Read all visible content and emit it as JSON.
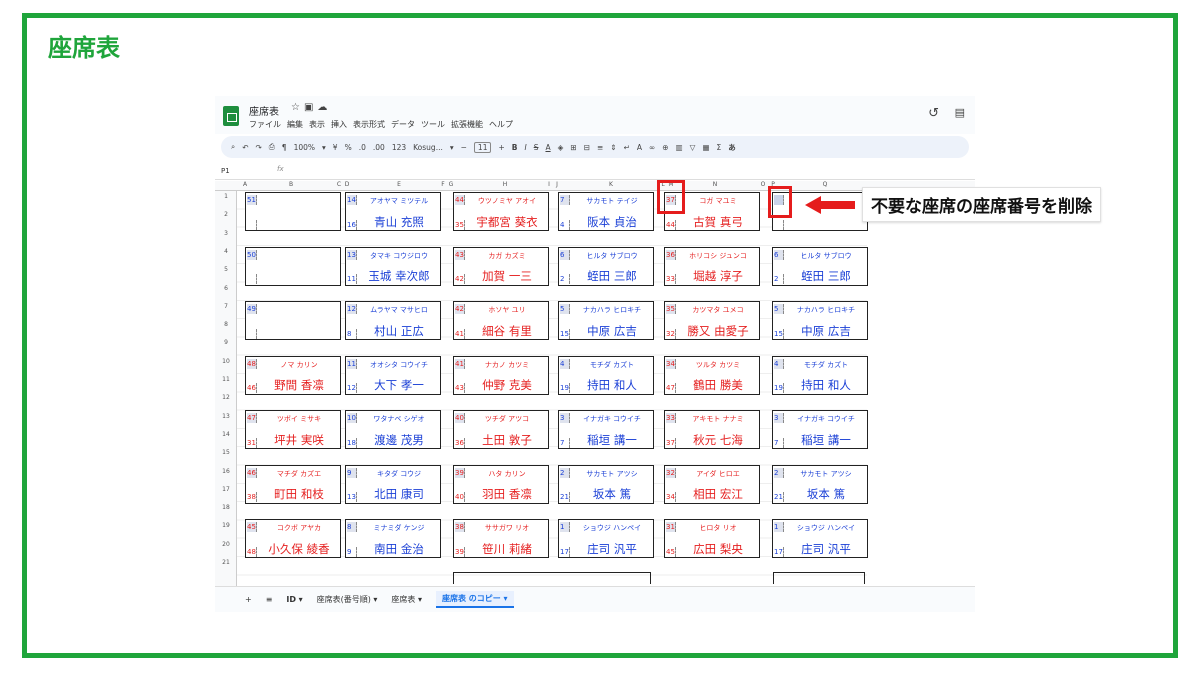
{
  "slide_title": "座席表",
  "callout_text": "不要な座席の座席番号を削除",
  "app": {
    "doc_title": "座席表",
    "menu": [
      "ファイル",
      "編集",
      "表示",
      "挿入",
      "表示形式",
      "データ",
      "ツール",
      "拡張機能",
      "ヘルプ"
    ],
    "zoom": "100%",
    "font": "Kosug...",
    "font_size": "11",
    "name_box": "P1",
    "fx": "fx",
    "columns": [
      "A",
      "B",
      "C",
      "D",
      "E",
      "F",
      "G",
      "H",
      "I",
      "J",
      "K",
      "L",
      "M",
      "N",
      "O",
      "P",
      "Q"
    ],
    "rows": [
      "1",
      "2",
      "3",
      "4",
      "5",
      "6",
      "7",
      "8",
      "9",
      "10",
      "11",
      "12",
      "13",
      "14",
      "15",
      "16",
      "17",
      "18",
      "19",
      "20",
      "21"
    ],
    "sheet_tabs": [
      "ID",
      "座席表(番号順)",
      "座席表",
      "座席表 のコピー"
    ]
  },
  "colors": {
    "accent": "#1fa53b",
    "blue_text": "#1a3fd6",
    "red_text": "#e52020",
    "highlight": "#e51c1c"
  },
  "seat_columns": [
    [
      {
        "n1": "51",
        "n2": "",
        "kana": "",
        "name": "",
        "color": "blue"
      },
      {
        "n1": "50",
        "n2": "",
        "kana": "",
        "name": "",
        "color": "blue"
      },
      {
        "n1": "49",
        "n2": "",
        "kana": "",
        "name": "",
        "color": "blue"
      },
      {
        "n1": "48",
        "n2": "46",
        "kana": "ノマ カリン",
        "name": "野間 香凛",
        "color": "red"
      },
      {
        "n1": "47",
        "n2": "31",
        "kana": "ツボイ ミサキ",
        "name": "坪井 実咲",
        "color": "red"
      },
      {
        "n1": "46",
        "n2": "38",
        "kana": "マチダ カズエ",
        "name": "町田 和枝",
        "color": "red"
      },
      {
        "n1": "45",
        "n2": "48",
        "kana": "コクボ アヤカ",
        "name": "小久保 綾香",
        "color": "red"
      }
    ],
    [
      {
        "n1": "14",
        "n2": "16",
        "kana": "アオヤマ ミツテル",
        "name": "青山 充照",
        "color": "blue"
      },
      {
        "n1": "13",
        "n2": "11",
        "kana": "タマキ コウジロウ",
        "name": "玉城 幸次郎",
        "color": "blue"
      },
      {
        "n1": "12",
        "n2": "8",
        "kana": "ムラヤマ マサヒロ",
        "name": "村山 正広",
        "color": "blue"
      },
      {
        "n1": "11",
        "n2": "12",
        "kana": "オオシタ コウイチ",
        "name": "大下 孝一",
        "color": "blue"
      },
      {
        "n1": "10",
        "n2": "18",
        "kana": "ワタナベ シゲオ",
        "name": "渡邊 茂男",
        "color": "blue"
      },
      {
        "n1": "9",
        "n2": "13",
        "kana": "キタダ コウジ",
        "name": "北田 康司",
        "color": "blue"
      },
      {
        "n1": "8",
        "n2": "9",
        "kana": "ミナミダ ケンジ",
        "name": "南田 金治",
        "color": "blue"
      }
    ],
    [
      {
        "n1": "44",
        "n2": "35",
        "kana": "ウツノミヤ アオイ",
        "name": "宇都宮 葵衣",
        "color": "red"
      },
      {
        "n1": "43",
        "n2": "42",
        "kana": "カガ カズミ",
        "name": "加賀 一三",
        "color": "red"
      },
      {
        "n1": "42",
        "n2": "41",
        "kana": "ホソヤ ユリ",
        "name": "細谷 有里",
        "color": "red"
      },
      {
        "n1": "41",
        "n2": "43",
        "kana": "ナカノ カツミ",
        "name": "仲野 克美",
        "color": "red"
      },
      {
        "n1": "40",
        "n2": "36",
        "kana": "ツチダ アツコ",
        "name": "土田 敦子",
        "color": "red"
      },
      {
        "n1": "39",
        "n2": "40",
        "kana": "ハタ カリン",
        "name": "羽田 香凛",
        "color": "red"
      },
      {
        "n1": "38",
        "n2": "39",
        "kana": "ササガワ リオ",
        "name": "笹川 莉緒",
        "color": "red"
      }
    ],
    [
      {
        "n1": "7",
        "n2": "4",
        "kana": "サカモト テイジ",
        "name": "阪本 貞治",
        "color": "blue"
      },
      {
        "n1": "6",
        "n2": "2",
        "kana": "ヒルタ サブロウ",
        "name": "蛭田 三郎",
        "color": "blue"
      },
      {
        "n1": "5",
        "n2": "15",
        "kana": "ナカハラ ヒロキチ",
        "name": "中原 広吉",
        "color": "blue"
      },
      {
        "n1": "4",
        "n2": "19",
        "kana": "モチダ カズト",
        "name": "持田 和人",
        "color": "blue"
      },
      {
        "n1": "3",
        "n2": "7",
        "kana": "イナガキ コウイチ",
        "name": "稲垣 講一",
        "color": "blue"
      },
      {
        "n1": "2",
        "n2": "21",
        "kana": "サカモト アツシ",
        "name": "坂本 篤",
        "color": "blue"
      },
      {
        "n1": "1",
        "n2": "17",
        "kana": "ショウジ ハンペイ",
        "name": "庄司 汎平",
        "color": "blue"
      }
    ],
    [
      {
        "n1": "37",
        "n2": "44",
        "kana": "コガ マユミ",
        "name": "古賀 真弓",
        "color": "red"
      },
      {
        "n1": "36",
        "n2": "33",
        "kana": "ホリコシ ジュンコ",
        "name": "堀越 淳子",
        "color": "red"
      },
      {
        "n1": "35",
        "n2": "32",
        "kana": "カツマタ ユメコ",
        "name": "勝又 由愛子",
        "color": "red"
      },
      {
        "n1": "34",
        "n2": "47",
        "kana": "ツルタ カツミ",
        "name": "鶴田 勝美",
        "color": "red"
      },
      {
        "n1": "33",
        "n2": "37",
        "kana": "アキモト ナナミ",
        "name": "秋元 七海",
        "color": "red"
      },
      {
        "n1": "32",
        "n2": "34",
        "kana": "アイダ ヒロエ",
        "name": "相田 宏江",
        "color": "red"
      },
      {
        "n1": "31",
        "n2": "45",
        "kana": "ヒロタ リオ",
        "name": "広田 梨央",
        "color": "red"
      }
    ],
    [
      {
        "n1": "",
        "n2": "",
        "kana": "",
        "name": "",
        "color": "blue"
      },
      {
        "n1": "6",
        "n2": "2",
        "kana": "ヒルタ サブロウ",
        "name": "蛭田 三郎",
        "color": "blue"
      },
      {
        "n1": "5",
        "n2": "15",
        "kana": "ナカハラ ヒロキチ",
        "name": "中原 広吉",
        "color": "blue"
      },
      {
        "n1": "4",
        "n2": "19",
        "kana": "モチダ カズト",
        "name": "持田 和人",
        "color": "blue"
      },
      {
        "n1": "3",
        "n2": "7",
        "kana": "イナガキ コウイチ",
        "name": "稲垣 講一",
        "color": "blue"
      },
      {
        "n1": "2",
        "n2": "21",
        "kana": "サカモト アツシ",
        "name": "坂本 篤",
        "color": "blue"
      },
      {
        "n1": "1",
        "n2": "17",
        "kana": "ショウジ ハンペイ",
        "name": "庄司 汎平",
        "color": "blue"
      }
    ]
  ]
}
